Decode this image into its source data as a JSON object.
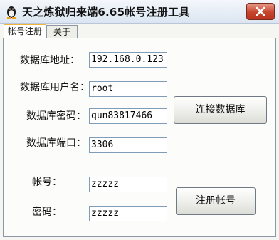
{
  "window": {
    "title": "天之炼狱归来端6.65帐号注册工具",
    "close_icon": "close-icon",
    "app_icon": "penguin-icon"
  },
  "tabs": [
    {
      "label": "帐号注册",
      "active": true
    },
    {
      "label": "关于",
      "active": false
    }
  ],
  "form": {
    "db_address_label": "数据库地址：",
    "db_address_value": "192.168.0.123",
    "db_user_label": "数据库用户名：",
    "db_user_value": "root",
    "db_password_label": "数据库密码：",
    "db_password_value": "qun83817466",
    "db_port_label": "数据库端口：",
    "db_port_value": "3306",
    "account_label": "帐号：",
    "account_value": "zzzzz",
    "password_label": "密码：",
    "password_value": "zzzzz"
  },
  "buttons": {
    "connect_label": "连接数据库",
    "register_label": "注册帐号"
  }
}
